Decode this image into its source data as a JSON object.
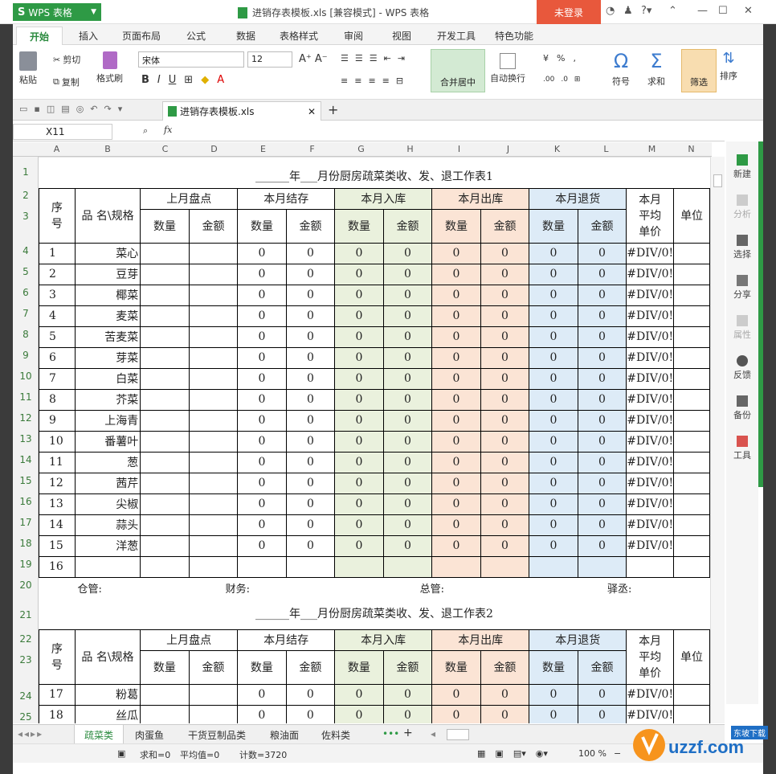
{
  "app": {
    "name": "WPS 表格",
    "window_title": "进销存表模板.xls [兼容模式] - WPS 表格",
    "login_label": "未登录"
  },
  "ribbon_tabs": [
    "开始",
    "插入",
    "页面布局",
    "公式",
    "数据",
    "表格样式",
    "审阅",
    "视图",
    "开发工具",
    "特色功能"
  ],
  "ribbon": {
    "paste": "粘贴",
    "cut": "剪切",
    "copy": "复制",
    "format_painter": "格式刷",
    "font_name": "宋体",
    "font_size": "12",
    "merge_center": "合并居中",
    "wrap": "自动换行",
    "symbol": "符号",
    "sum": "求和",
    "filter": "筛选",
    "sort": "排序"
  },
  "doc_tab": "进销存表模板.xls",
  "name_box": "X11",
  "columns": [
    "A",
    "B",
    "C",
    "D",
    "E",
    "F",
    "G",
    "H",
    "I",
    "J",
    "K",
    "L",
    "M",
    "N"
  ],
  "rows": [
    "1",
    "2",
    "3",
    "4",
    "5",
    "6",
    "7",
    "8",
    "9",
    "10",
    "11",
    "12",
    "13",
    "14",
    "15",
    "16",
    "17",
    "18",
    "19",
    "20",
    "21",
    "22",
    "23",
    "24",
    "25"
  ],
  "sheet": {
    "title1": "______年___月份厨房疏菜类收、发、退工作表1",
    "title2": "______年___月份厨房疏菜类收、发、退工作表2",
    "h_seq": "序号",
    "h_name": "品 名\\规格",
    "h_last": "上月盘点",
    "h_stock": "本月结存",
    "h_in": "本月入库",
    "h_out": "本月出库",
    "h_ret": "本月退货",
    "h_avg": "本月平均单价",
    "h_unit": "单位",
    "h_qty": "数量",
    "h_amt": "金额",
    "zero": "0",
    "divzero": "#DIV/0!",
    "items": [
      {
        "n": "1",
        "name": "菜心"
      },
      {
        "n": "2",
        "name": "豆芽"
      },
      {
        "n": "3",
        "name": "椰菜"
      },
      {
        "n": "4",
        "name": "麦菜"
      },
      {
        "n": "5",
        "name": "苦麦菜"
      },
      {
        "n": "6",
        "name": "芽菜"
      },
      {
        "n": "7",
        "name": "白菜"
      },
      {
        "n": "8",
        "name": "芥菜"
      },
      {
        "n": "9",
        "name": "上海青"
      },
      {
        "n": "10",
        "name": "番薯叶"
      },
      {
        "n": "11",
        "name": "葱"
      },
      {
        "n": "12",
        "name": "茜芹"
      },
      {
        "n": "13",
        "name": "尖椒"
      },
      {
        "n": "14",
        "name": "蒜头"
      },
      {
        "n": "15",
        "name": "洋葱"
      },
      {
        "n": "16",
        "name": ""
      }
    ],
    "items2": [
      {
        "n": "17",
        "name": "粉葛"
      },
      {
        "n": "18",
        "name": "丝瓜"
      }
    ],
    "footer": {
      "a": "仓管:",
      "b": "财务:",
      "c": "总管:",
      "d": "驿丞:"
    }
  },
  "side_panel": [
    "新建",
    "分析",
    "选择",
    "分享",
    "属性",
    "反馈",
    "备份",
    "工具"
  ],
  "sheet_tabs": [
    "疏菜类",
    "肉蛋鱼",
    "干货豆制品类",
    "粮油面",
    "佐料类"
  ],
  "status": {
    "sum": "求和=0",
    "avg": "平均值=0",
    "count": "计数=3720",
    "zoom": "100 %"
  },
  "watermark": "uzzf.com",
  "watermark_sub": "东坡下载"
}
